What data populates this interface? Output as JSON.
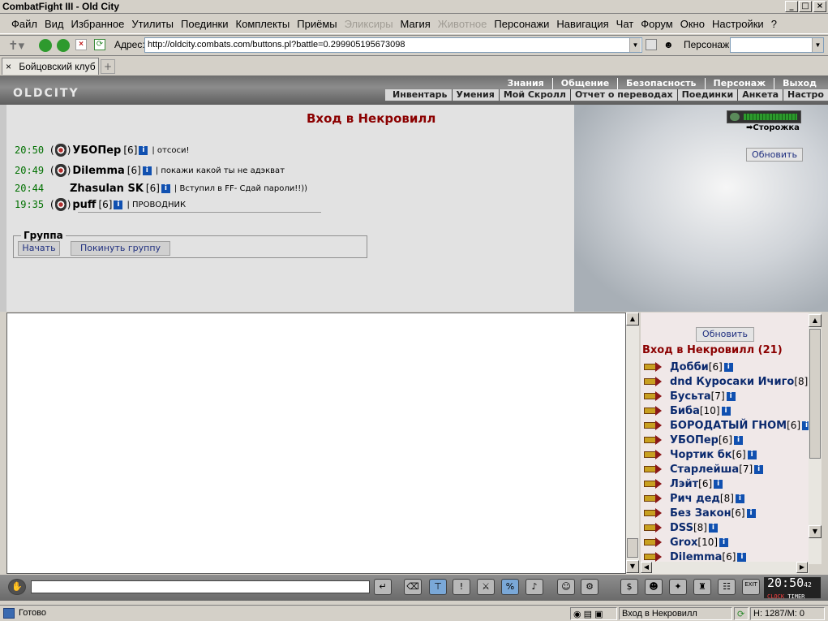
{
  "window": {
    "title": "CombatFight III - Old City",
    "min": "_",
    "max": "□",
    "close": "×"
  },
  "menu": [
    "Файл",
    "Вид",
    "Избранное",
    "Утилиты",
    "Поединки",
    "Комплекты",
    "Приёмы",
    "Эликсиры",
    "Магия",
    "Животное",
    "Персонажи",
    "Навигация",
    "Чат",
    "Форум",
    "Окно",
    "Настройки",
    "?"
  ],
  "menu_disabled": [
    "Эликсиры",
    "Животное"
  ],
  "address": {
    "label": "Адрес:",
    "url": "http://oldcity.combats.com/buttons.pl?battle=0.299905195673098",
    "person_label": "Персонаж:"
  },
  "tab": {
    "title": "Бойцовский клуб",
    "close": "×",
    "new": "+"
  },
  "header": {
    "logo": "OLDCITY",
    "top_links": [
      "Знания",
      "Общение",
      "Безопасность",
      "Персонаж",
      "Выход"
    ],
    "bottom_links": [
      "Инвентарь",
      "Умения",
      "Мой Скролл",
      "Отчет о переводах",
      "Поединки",
      "Анкета",
      "Настро"
    ]
  },
  "battle": {
    "title": "Вход в Некровилл",
    "log": [
      {
        "time": "20:50",
        "nick": "УБОПер",
        "level": "[6]",
        "message": "| отсоси!",
        "shield": true
      },
      {
        "time": "20:49",
        "nick": "Dilemma",
        "level": "[6]",
        "message": "| покажи какой ты не адэкват",
        "shield": true
      },
      {
        "time": "20:44",
        "nick": "Zhasulan SK",
        "level": "[6]",
        "message": "| Вступил в FF- Сдай пароли!!))",
        "shield": false
      },
      {
        "time": "19:35",
        "nick": "puff",
        "level": "[6]",
        "message": "| ПРОВОДНИК",
        "shield": true
      }
    ],
    "group_legend": "Группа",
    "start_button": "Начать",
    "leave_button": "Покинуть группу",
    "guard_label": "Сторожка",
    "refresh": "Обновить"
  },
  "userlist": {
    "refresh": "Обновить",
    "title": "Вход в Некровилл (21)",
    "users": [
      {
        "name": "Добби",
        "level": "[6]"
      },
      {
        "name": "dnd Куросаки Ичиго",
        "level": "[8]"
      },
      {
        "name": "Бусьта",
        "level": "[7]"
      },
      {
        "name": "Биба",
        "level": "[10]"
      },
      {
        "name": "БОРОДАТЫЙ ГНОМ",
        "level": "[6]"
      },
      {
        "name": "УБОПер",
        "level": "[6]"
      },
      {
        "name": "Чортик бк",
        "level": "[6]"
      },
      {
        "name": "Старлейша",
        "level": "[7]"
      },
      {
        "name": "Лэйт",
        "level": "[6]"
      },
      {
        "name": "Рич дед",
        "level": "[8]"
      },
      {
        "name": "Без Закон",
        "level": "[6]"
      },
      {
        "name": "DSS",
        "level": "[8]"
      },
      {
        "name": "Grox",
        "level": "[10]"
      },
      {
        "name": "Dilemma",
        "level": "[6]"
      }
    ]
  },
  "toolbar": {
    "clock": "20:50",
    "clock_sec": "42",
    "clock_label": "CLOCK",
    "timer_label": "TIMER",
    "exit_label": "EXIT"
  },
  "status": {
    "text": "Готово",
    "window": "Вход в Некровилл",
    "hp": "H: 1287/M: 0"
  },
  "colors": {
    "title_red": "#8b0000",
    "nick_blue": "#0b2a6e",
    "time_green": "#007000"
  }
}
